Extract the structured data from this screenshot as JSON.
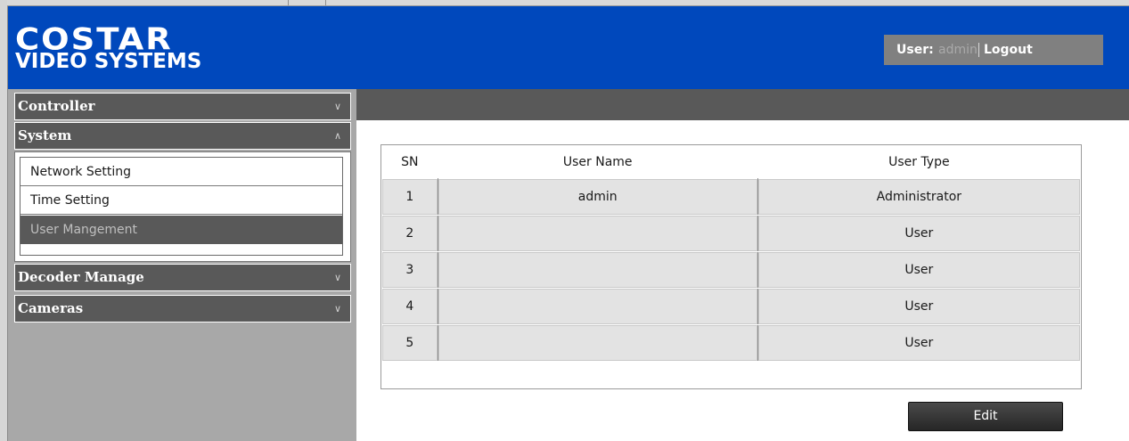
{
  "header": {
    "logo_line1": "COSTAR",
    "logo_line2": "VIDEO SYSTEMS",
    "user_label": "User:",
    "user_name": "admin",
    "logout_label": "Logout",
    "background_color": "#0048bc"
  },
  "sidebar": {
    "sections": [
      {
        "label": "Controller",
        "state": "collapsed",
        "icon": "chevron-down-icon"
      },
      {
        "label": "System",
        "state": "expanded",
        "icon": "chevron-up-icon"
      },
      {
        "label": "Decoder Manage",
        "state": "collapsed",
        "icon": "chevron-down-icon"
      },
      {
        "label": "Cameras",
        "state": "collapsed",
        "icon": "chevron-down-icon"
      }
    ],
    "system_items": [
      {
        "label": "Network Setting",
        "active": false
      },
      {
        "label": "Time Setting",
        "active": false
      },
      {
        "label": "User Mangement",
        "active": true
      }
    ]
  },
  "users_table": {
    "columns": [
      "SN",
      "User Name",
      "User Type"
    ],
    "rows": [
      {
        "sn": "1",
        "name": "admin",
        "type": "Administrator"
      },
      {
        "sn": "2",
        "name": "",
        "type": "User"
      },
      {
        "sn": "3",
        "name": "",
        "type": "User"
      },
      {
        "sn": "4",
        "name": "",
        "type": "User"
      },
      {
        "sn": "5",
        "name": "",
        "type": "User"
      }
    ]
  },
  "actions": {
    "edit_label": "Edit"
  },
  "colors": {
    "accent_dark": "#595959",
    "sidebar_bg": "#a8a8a8",
    "row_bg": "#e3e3e3"
  }
}
